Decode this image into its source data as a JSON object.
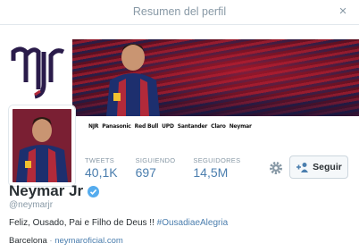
{
  "modal": {
    "title": "Resumen del perfil",
    "close_glyph": "×"
  },
  "banner": {
    "logo_text": "njr",
    "sponsors": [
      "NJR",
      "Panasonic",
      "Red Bull",
      "UPD",
      "Santander",
      "Claro",
      "Neymar"
    ]
  },
  "stats": [
    {
      "label": "TWEETS",
      "value": "40,1K"
    },
    {
      "label": "SIGUIENDO",
      "value": "697"
    },
    {
      "label": "SEGUIDORES",
      "value": "14,5M"
    }
  ],
  "actions": {
    "follow_label": "Seguir",
    "icons": [
      "gear-icon",
      "person-add-icon"
    ]
  },
  "profile": {
    "name": "Neymar Jr",
    "handle": "@neymarjr",
    "bio_text": "Feliz, Ousado, Pai e Filho de Deus !! ",
    "bio_hashtag": "#OusadiaeAlegria",
    "location": "Barcelona",
    "separator": " · ",
    "url": "neymaroficial.com"
  },
  "colors": {
    "link": "#4b7eae",
    "muted": "#8899a6",
    "text": "#292f33",
    "verified": "#55acee"
  }
}
